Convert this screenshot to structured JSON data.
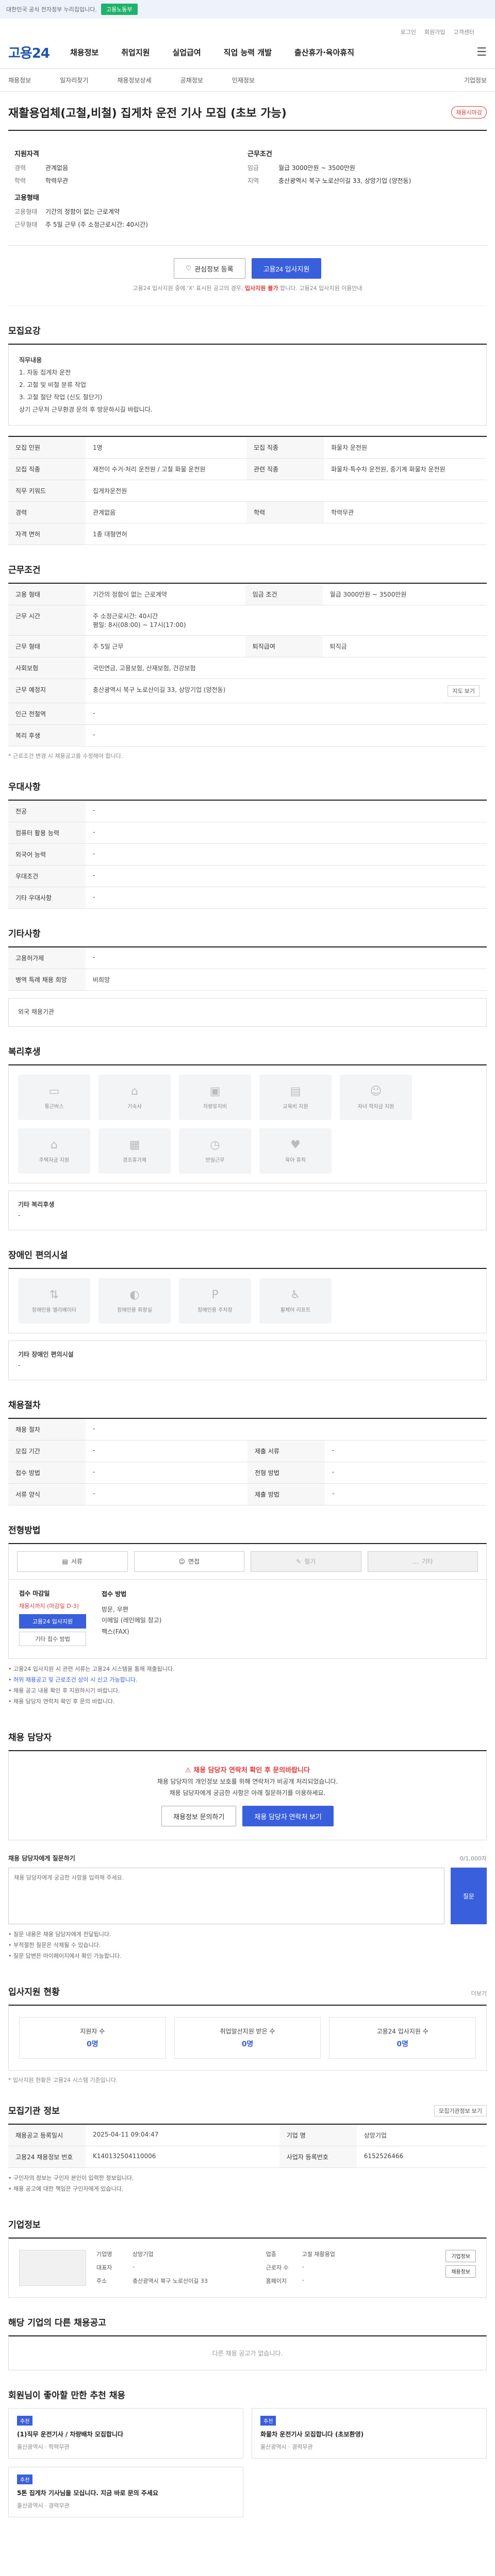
{
  "topbar": {
    "text": "대한민국 공식 전자정부 누리집입니다.",
    "flag": "고용노동부"
  },
  "util": [
    "로그인",
    "회원가입",
    "고객센터"
  ],
  "gnb": {
    "logo": "고용24",
    "items": [
      "채용정보",
      "취업지원",
      "실업급여",
      "직업 능력 개발",
      "출산휴가·육아휴직"
    ],
    "menu_icon": "hamburger-icon"
  },
  "subnav": {
    "items": [
      "채용정보",
      "일자리찾기",
      "채용정보상세",
      "공채정보",
      "인재정보"
    ],
    "right": "기업정보"
  },
  "job": {
    "title": "재활용업체(고철,비철) 집게차 운전 기사 모집 (초보 가능)",
    "badge": "채용시마감",
    "left_title": "지원자격",
    "left": [
      {
        "k": "경력",
        "v": "관계없음"
      },
      {
        "k": "학력",
        "v": "학력무관"
      }
    ],
    "left_title2": "고용형태",
    "left2": [
      {
        "k": "고용형태",
        "v": "기간의 정함이 없는 근로계약"
      },
      {
        "k": "근무형태",
        "v": "주 5일 근무 (주 소정근로시간: 40시간)"
      }
    ],
    "right_title": "근무조건",
    "right": [
      {
        "k": "임금",
        "v": "월급 3000만원 ~ 3500만원"
      },
      {
        "k": "지역",
        "v": "충산광역시 북구 노로산이길 33, 상망기업 (양전동)"
      }
    ]
  },
  "actions": {
    "scrap": "관심정보 등록",
    "apply": "고용24 입사지원"
  },
  "notice": {
    "pre": "고용24 입사지원 중에 'X' 표시된 공고의 경우, ",
    "red": "입사지원 불가",
    "post": "합니다. 고용24 입사지원 이용안내"
  },
  "recruit": {
    "title": "모집요강",
    "intro": "직무내용",
    "lines": [
      "1. 자동 집게차 운전",
      "2. 고철 및 비철 분류 작업",
      "3. 고철 절단 작업 (신도 절단기)",
      "상기 근무처 근무환경 문의 후 방문하시길 바랍니다."
    ]
  },
  "recruit_table": [
    {
      "k": "모집 인원",
      "v": "1명",
      "k2": "모집 직종",
      "v2": "화물차 운전원"
    },
    {
      "k": "모집 직종",
      "v": "재전이 수거·처리 운전원 / 고철 화물 운전원",
      "k2": "관련 직종",
      "v2": "화물차·특수차 운전원, 중기계 화물차 운전원"
    },
    {
      "k": "직무 키워드",
      "v": "집게차운전원",
      "k2": "",
      "v2": ""
    },
    {
      "k": "경력",
      "v": "관계없음",
      "k2": "학력",
      "v2": "학력무관"
    },
    {
      "k": "자격 면허",
      "v": "1종 대형면허",
      "k2": "",
      "v2": ""
    }
  ],
  "conditions": {
    "title": "근무조건",
    "rows": [
      {
        "k": "고용 형태",
        "v": "기간의 정함이 없는 근로계약",
        "k2": "임금 조건",
        "v2": "월급 3000만원 ~ 3500만원"
      },
      {
        "k": "근무 시간",
        "v": "주 소정근로시간: 40시간",
        "k2": "",
        "v2": ""
      },
      {
        "k": "근무 형태",
        "v": "주 5일 근무",
        "k2": "퇴직급여",
        "v2": "퇴직금"
      },
      {
        "k": "사회보험",
        "v": "국민연금, 고용보험, 산재보험, 건강보험",
        "k2": "",
        "v2": ""
      },
      {
        "k": "근무 예정지",
        "v": "충산광역시 북구 노로산이길 33, 상망기업 (양전동)",
        "k2": "",
        "v2": ""
      },
      {
        "k": "인근 전철역",
        "v": "-",
        "k2": "",
        "v2": ""
      },
      {
        "k": "복리 후생",
        "v": "-",
        "k2": "",
        "v2": ""
      }
    ],
    "map_btn": "지도 보기",
    "time_detail": "평일: 8시(08:00) ~ 17시(17:00)",
    "note": "* 근로조건 변경 시 채용공고를 수정해야 합니다."
  },
  "pref": {
    "title": "우대사항",
    "rows": [
      {
        "k": "전공",
        "v": "-"
      },
      {
        "k": "컴퓨터 활용 능력",
        "v": "-"
      },
      {
        "k": "외국어 능력",
        "v": "-"
      },
      {
        "k": "우대조건",
        "v": "-"
      },
      {
        "k": "기타 우대사항",
        "v": "-"
      }
    ]
  },
  "etc": {
    "title": "기타사항",
    "rows": [
      {
        "k": "고용허가제",
        "v": "-"
      },
      {
        "k": "병역 특례 채용 희망",
        "v": "비희망"
      }
    ],
    "more": "외국 채용기관"
  },
  "welfare": {
    "title": "복리후생",
    "icons": [
      "통근버스",
      "기숙사",
      "차량유지비",
      "교육비 지원",
      "자녀 학자금 지원",
      "주택자금 지원",
      "경조휴가제",
      "반일근무",
      "육아 휴직"
    ],
    "label": "기타 복리후생",
    "value": "-"
  },
  "disabled": {
    "title": "장애인 편의시설",
    "icons": [
      "장애인용 엘리베이터",
      "장애인용 화장실",
      "장애인용 주차장",
      "휠체어 리프트"
    ],
    "label": "기타 장애인 편의시설",
    "value": "-"
  },
  "process": {
    "title": "채용절차",
    "rows": [
      {
        "k": "채용 절차",
        "v": "-",
        "k2": "",
        "v2": ""
      },
      {
        "k": "모집 기간",
        "v": "-",
        "k2": "제출 서류",
        "v2": "-"
      },
      {
        "k": "접수 방법",
        "v": "-",
        "k2": "전형 방법",
        "v2": "-"
      },
      {
        "k": "서류 양식",
        "v": "-",
        "k2": "제출 방법",
        "v2": "-"
      }
    ]
  },
  "apply": {
    "title": "전형방법",
    "steps": [
      "서류",
      "면접",
      "필기",
      "기타"
    ],
    "lbl": "접수 마감일",
    "deadline": "채용시까지 (마감일 D-3)",
    "btn": "고용24 입사지원",
    "btn2": "기타 접수 방법",
    "method_lbl": "접수 방법",
    "methods": [
      "방문, 우편",
      "이메일 (레인메일 참고)",
      "팩스(FAX)"
    ],
    "bullets": [
      "고용24 입사지원 시 관련 서류는 고용24 시스템을 통해 제출됩니다.",
      "허위 채용공고 및 근로조건 상이 시 신고 가능합니다.",
      "채용 공고 내용 확인 후 지원하시기 바랍니다.",
      "채용 담당자 연락처 확인 후 문의 바랍니다."
    ]
  },
  "manager": {
    "title": "채용 담당자",
    "warn": "채용 담당자 연락처 확인 후 문의바랍니다",
    "desc": "채용 담당자의 개인정보 보호를 위해 연락처가 비공개 처리되었습니다.",
    "desc2": "채용 담당자에게 궁금한 사항은 아래 질문하기를 이용하세요.",
    "btn": "채용정보 문의하기",
    "btn2": "채용 담당자 연락처 보기"
  },
  "ask": {
    "label": "채용 담당자에게 질문하기",
    "hint": "0/1,000자",
    "placeholder": "채용 담당자에게 궁금한 사항을 입력해 주세요.",
    "send": "질문"
  },
  "ask_notes": [
    "질문 내용은 채용 담당자에게 전달됩니다.",
    "부적절한 질문은 삭제될 수 있습니다.",
    "질문 답변은 마이페이지에서 확인 가능합니다."
  ],
  "stats": {
    "title": "입사지원 현황",
    "more": "더보기",
    "items": [
      {
        "label": "지원자 수",
        "num": "0명"
      },
      {
        "label": "취업알선지원 받은 수",
        "num": "0명"
      },
      {
        "label": "고용24 입사지원 수",
        "num": "0명"
      }
    ],
    "note": "* 입사지원 현황은 고용24 시스템 기준입니다."
  },
  "reg": {
    "title": "모집기관 정보",
    "btn": "모집기관정보 보기",
    "rows": [
      {
        "k": "채용공고 등록일시",
        "v": "2025-04-11 09:04:47",
        "k2": "기업 명",
        "v2": "상망기업"
      },
      {
        "k": "고용24 채용정보 번호",
        "v": "K140132504110006",
        "k2": "사업자 등록번호",
        "v2": "6152526466"
      }
    ],
    "notes": [
      "구인자의 정보는 구인자 본인이 입력한 정보입니다.",
      "채용 공고에 대한 책임은 구인자에게 있습니다."
    ]
  },
  "company": {
    "title": "기업정보",
    "rows": [
      {
        "k": "기업명",
        "v": "상망기업"
      },
      {
        "k": "업종",
        "v": "고철 재활용업"
      },
      {
        "k": "대표자",
        "v": "-"
      },
      {
        "k": "근로자 수",
        "v": "-"
      },
      {
        "k": "주소",
        "v": "충산광역시 북구 노로산이길 33"
      },
      {
        "k": "홈페이지",
        "v": "-"
      }
    ],
    "btn": "기업정보",
    "btn2": "채용정보"
  },
  "others": {
    "title": "해당 기업의 다른 채용공고",
    "empty": "다른 채용 공고가 없습니다."
  },
  "recommend": {
    "title": "회원님이 좋아할 만한 추천 채용",
    "cards": [
      {
        "tag": "추천",
        "t": "(1)직무 운전기사 / 차량배차 모집합니다",
        "m": "울산광역시 · 학력무관"
      },
      {
        "tag": "추천",
        "t": "화물차 운전기사 모집합니다 (초보환영)",
        "m": "울산광역시 · 경력무관"
      },
      {
        "tag": "추천",
        "t": "5톤 집게차 기사님을 모십니다. 지금 바로 문의 주세요",
        "m": "울산광역시 · 경력무관"
      }
    ]
  }
}
